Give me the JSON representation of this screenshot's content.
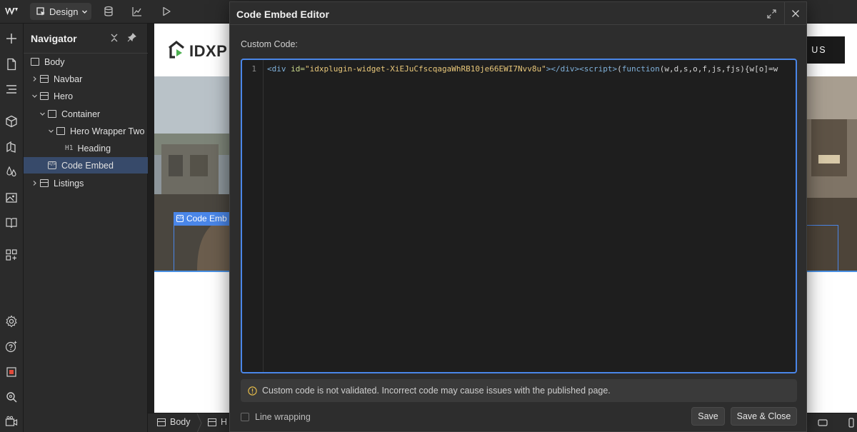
{
  "topbar": {
    "mode_label": "Design",
    "icons": [
      "webflow-logo-icon",
      "cursor-icon",
      "chevron-down-icon",
      "database-icon",
      "analytics-icon",
      "preview-play-icon"
    ]
  },
  "rail": {
    "icons": [
      "add-icon",
      "pages-icon",
      "navigator-icon",
      "components-icon",
      "style-manager-icon",
      "color-variables-icon",
      "assets-icon",
      "cms-icon",
      "apps-icon",
      "settings-icon",
      "help-icon",
      "audit-icon",
      "search-icon",
      "video-icon"
    ]
  },
  "navigator": {
    "title": "Navigator",
    "items": [
      {
        "label": "Body"
      },
      {
        "label": "Navbar"
      },
      {
        "label": "Hero"
      },
      {
        "label": "Container"
      },
      {
        "label": "Hero Wrapper Two"
      },
      {
        "label": "Heading",
        "tag": "H1"
      },
      {
        "label": "Code Embed",
        "selected": true
      },
      {
        "label": "Listings"
      }
    ]
  },
  "canvas": {
    "logo_text": "IDXP",
    "contact_label": "T US",
    "selection_label": "Code Emb"
  },
  "breadcrumb": {
    "items": [
      "Body",
      "H"
    ]
  },
  "modal": {
    "title": "Code Embed Editor",
    "field_label": "Custom Code:",
    "line_number": "1",
    "code": {
      "p1": "<div ",
      "p2": "id=",
      "p3": "\"idxplugin-widget-XiEJuCfscqagaWhRB10je66EWI7Nvv8u\"",
      "p4": "></div><script>",
      "p5": "(",
      "p6": "function",
      "p7": "(w,d,s,o,f,js,fjs){w[o]=w"
    },
    "warning": "Custom code is not validated. Incorrect code may cause issues with the published page.",
    "line_wrapping_label": "Line wrapping",
    "line_wrapping_checked": false,
    "save_label": "Save",
    "save_close_label": "Save & Close"
  },
  "colors": {
    "accent": "#4a86e8",
    "panel": "#2b2b2b",
    "editor_bg": "#1e1e1e"
  }
}
